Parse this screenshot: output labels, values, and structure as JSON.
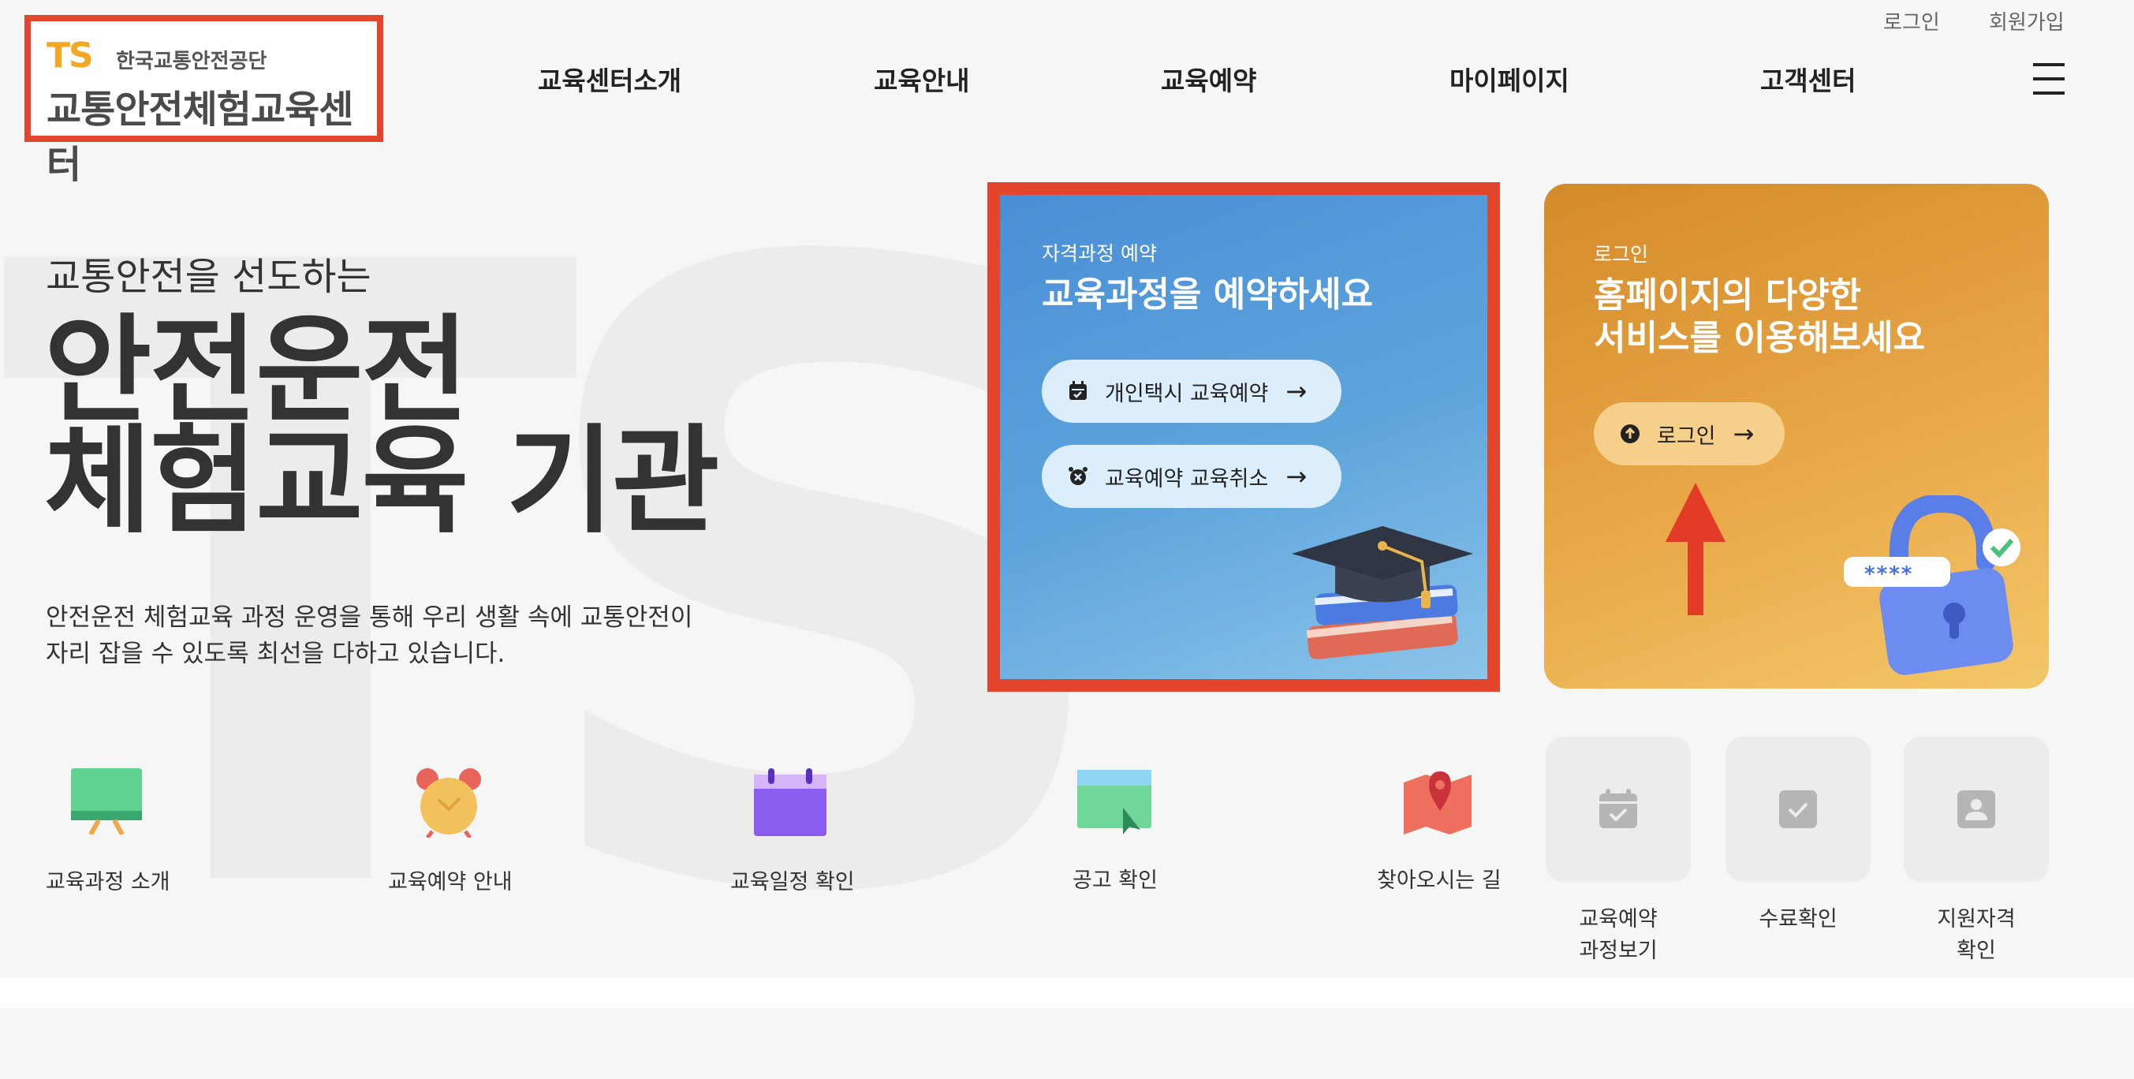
{
  "header": {
    "logo": {
      "mark": "TS",
      "org": "한국교통안전공단",
      "title": "교통안전체험교육센터"
    },
    "util_links": [
      "로그인",
      "회원가입"
    ],
    "nav": [
      "교육센터소개",
      "교육안내",
      "교육예약",
      "마이페이지",
      "고객센터"
    ],
    "menu_icon": "hamburger-icon"
  },
  "hero": {
    "background_mark": "TS",
    "subtitle": "교통안전을 선도하는",
    "title_line1": "안전운전",
    "title_line2": "체험교육 기관",
    "desc_line1": "안전운전 체험교육 과정 운영을 통해 우리 생활 속에 교통안전이",
    "desc_line2": "자리 잡을 수 있도록 최선을 다하고 있습니다."
  },
  "reservation_card": {
    "category": "자격과정 예약",
    "heading": "교육과정을 예약하세요",
    "buttons": [
      {
        "label": "개인택시 교육예약",
        "icon": "calendar-icon"
      },
      {
        "label": "교육예약 교육취소",
        "icon": "alarm-clock-icon"
      }
    ],
    "arrow": "→",
    "illustration": "graduation-cap-books"
  },
  "login_card": {
    "category": "로그인",
    "heading_line1": "홈페이지의 다양한",
    "heading_line2": "서비스를 이용해보세요",
    "button_label": "로그인",
    "arrow": "→",
    "illustration": "padlock",
    "password_mask": "****"
  },
  "quick_menu": [
    {
      "label": "교육과정 소개",
      "icon": "whiteboard-icon"
    },
    {
      "label": "교육예약 안내",
      "icon": "alarm-clock-icon"
    },
    {
      "label": "교육일정 확인",
      "icon": "calendar-icon"
    },
    {
      "label": "공고 확인",
      "icon": "notice-board-icon"
    },
    {
      "label": "찾아오시는 길",
      "icon": "map-pin-icon"
    }
  ],
  "service_tiles": [
    {
      "label_line1": "교육예약",
      "label_line2": "과정보기",
      "icon": "calendar-check-icon"
    },
    {
      "label_line1": "수료확인",
      "label_line2": "",
      "icon": "check-box-icon"
    },
    {
      "label_line1": "지원자격",
      "label_line2": "확인",
      "icon": "user-card-icon"
    }
  ],
  "colors": {
    "highlight_frame": "#e3452c",
    "blue_card": "#4a8ed6",
    "orange_card": "#e9a848",
    "arrow_annotation": "#e23b26"
  }
}
